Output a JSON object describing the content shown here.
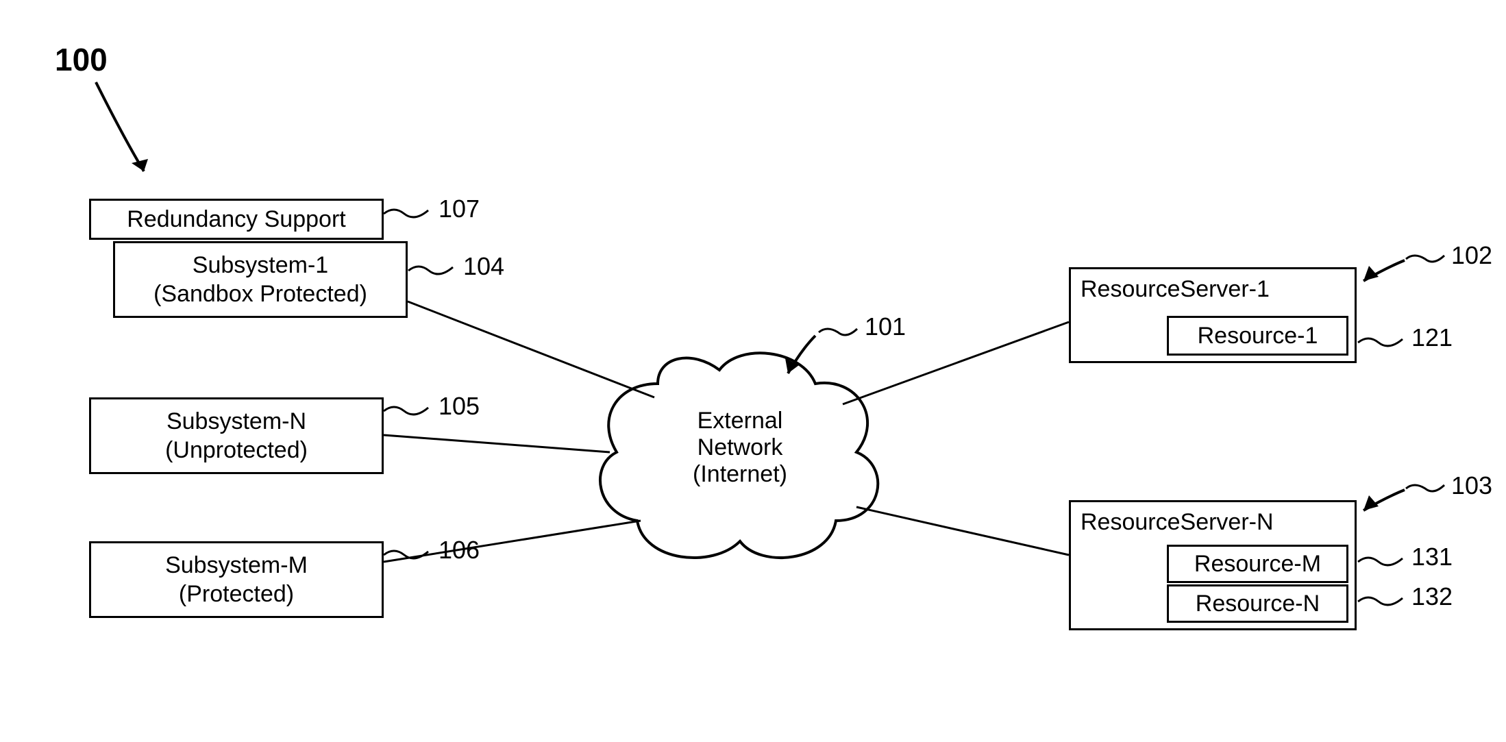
{
  "figure_number": "100",
  "redundancy": {
    "label": "Redundancy Support",
    "ref": "107"
  },
  "subsystem1": {
    "line1": "Subsystem-1",
    "line2": "(Sandbox Protected)",
    "ref": "104"
  },
  "subsystemN": {
    "line1": "Subsystem-N",
    "line2": "(Unprotected)",
    "ref": "105"
  },
  "subsystemM": {
    "line1": "Subsystem-M",
    "line2": "(Protected)",
    "ref": "106"
  },
  "cloud": {
    "line1": "External",
    "line2": "Network",
    "line3": "(Internet)",
    "ref": "101"
  },
  "server1": {
    "label": "ResourceServer-1",
    "ref": "102",
    "resource1": {
      "label": "Resource-1",
      "ref": "121"
    }
  },
  "serverN": {
    "label": "ResourceServer-N",
    "ref": "103",
    "resourceM": {
      "label": "Resource-M",
      "ref": "131"
    },
    "resourceN": {
      "label": "Resource-N",
      "ref": "132"
    }
  }
}
